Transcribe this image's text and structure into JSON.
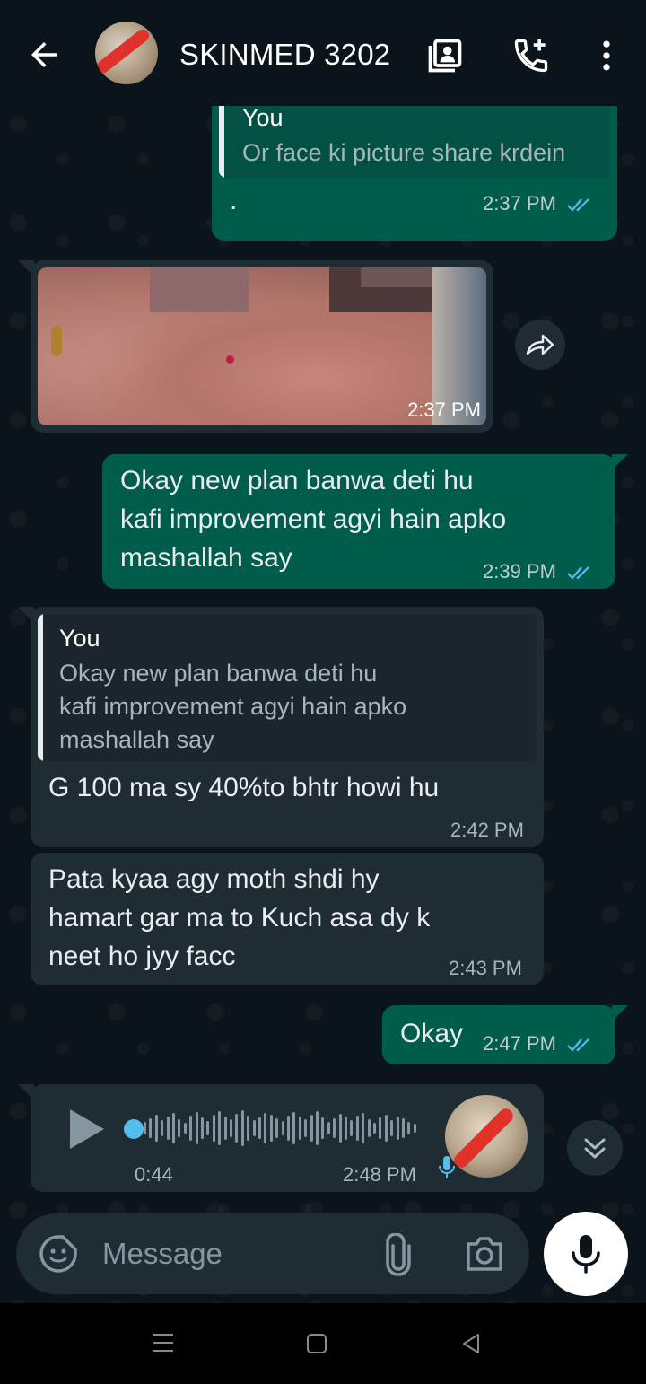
{
  "header": {
    "title": "SKINMED 3202",
    "back_icon": "arrow-left-icon",
    "contact_icon": "contact-card-icon",
    "call_icon": "add-call-icon",
    "menu_icon": "more-vertical-icon"
  },
  "messages": {
    "m1": {
      "quote_name": "You",
      "quote_text": "Or face ki picture share krdein",
      "text": ".",
      "time": "2:37 PM"
    },
    "m2": {
      "time": "2:37 PM"
    },
    "m3": {
      "line1": "Okay new plan banwa deti hu",
      "line2": "kafi improvement agyi hain apko",
      "line3": "mashallah say",
      "time": "2:39 PM"
    },
    "m4": {
      "quote_name": "You",
      "quote_line1": "Okay new plan banwa deti hu",
      "quote_line2": "kafi improvement agyi hain apko",
      "quote_line3": "mashallah say",
      "text": "G 100 ma sy 40%to bhtr howi hu",
      "time": "2:42 PM"
    },
    "m5": {
      "line1": "Pata kyaa agy moth   shdi hy",
      "line2": "hamart gar ma to Kuch asa dy k",
      "line3": "neet ho jyy facc",
      "time": "2:43 PM"
    },
    "m6": {
      "text": "Okay",
      "time": "2:47 PM"
    },
    "m7": {
      "duration": "0:44",
      "time": "2:48 PM"
    }
  },
  "composer": {
    "placeholder": "Message",
    "emoji_icon": "sticker-icon",
    "attach_icon": "paperclip-icon",
    "camera_icon": "camera-icon",
    "mic_icon": "mic-icon"
  },
  "colors": {
    "outgoing": "#005c4b",
    "incoming": "#1f2c34",
    "read_tick": "#53bdeb",
    "background": "#0b141a"
  }
}
